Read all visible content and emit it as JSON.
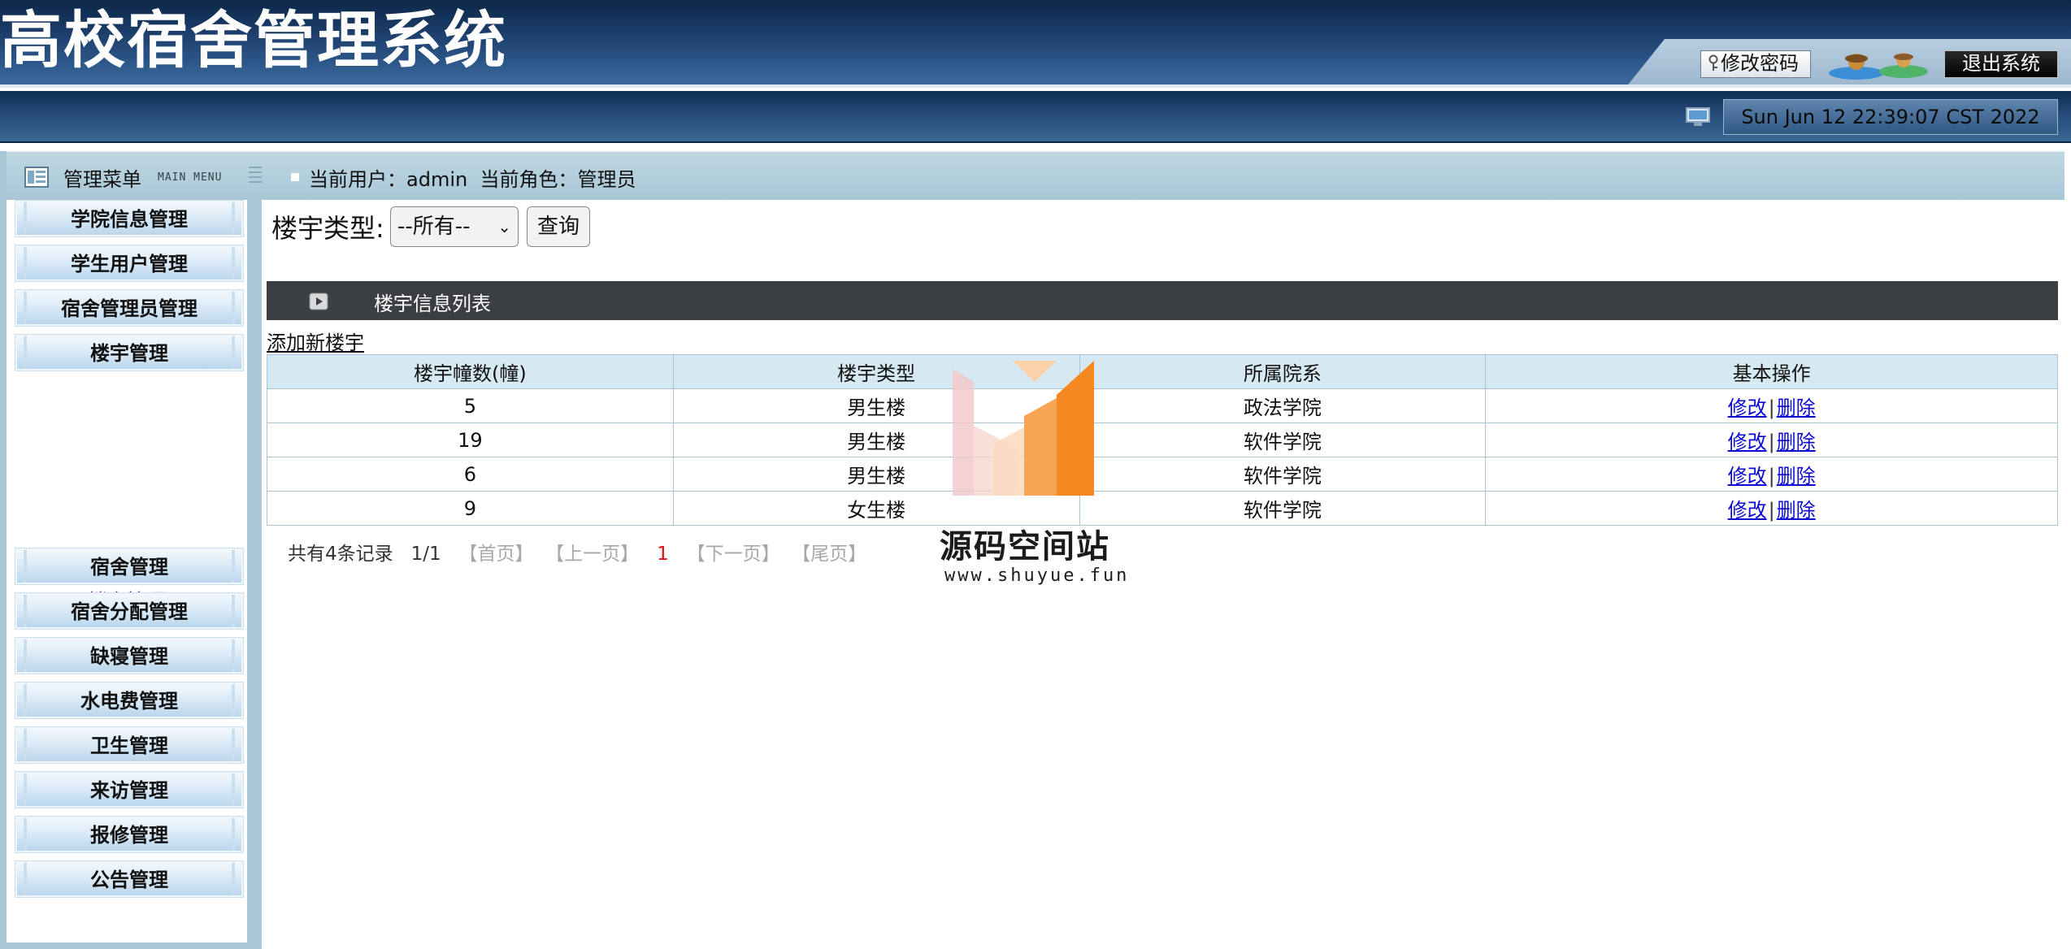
{
  "header": {
    "title": "高校宿舍管理系统",
    "change_password": "修改密码",
    "logout": "退出系统"
  },
  "status": {
    "datetime": "Sun Jun 12 22:39:07 CST 2022"
  },
  "menubar": {
    "title": "管理菜单",
    "title_en": "MAIN MENU",
    "user_info": "当前用户：admin  当前角色：管理员"
  },
  "sidebar": {
    "items": [
      {
        "label": "学院信息管理"
      },
      {
        "label": "学生用户管理"
      },
      {
        "label": "宿舍管理员管理"
      },
      {
        "label": "楼宇管理"
      },
      {
        "label": "宿舍管理"
      },
      {
        "label": "宿舍分配管理"
      },
      {
        "label": "缺寝管理"
      },
      {
        "label": "水电费管理"
      },
      {
        "label": "卫生管理"
      },
      {
        "label": "来访管理"
      },
      {
        "label": "报修管理"
      },
      {
        "label": "公告管理"
      }
    ],
    "submenu": {
      "label": "楼宇管理"
    }
  },
  "filter": {
    "label": "楼宇类型:",
    "selected": "--所有--",
    "query_button": "查询"
  },
  "list": {
    "title": "楼宇信息列表",
    "add_link": "添加新楼宇",
    "columns": [
      "楼宇幢数(幢)",
      "楼宇类型",
      "所属院系",
      "基本操作"
    ],
    "rows": [
      {
        "count": "5",
        "type": "男生楼",
        "dept": "政法学院"
      },
      {
        "count": "19",
        "type": "男生楼",
        "dept": "软件学院"
      },
      {
        "count": "6",
        "type": "男生楼",
        "dept": "软件学院"
      },
      {
        "count": "9",
        "type": "女生楼",
        "dept": "软件学院"
      }
    ],
    "ops": {
      "edit": "修改",
      "sep": "|",
      "delete": "删除"
    }
  },
  "pager": {
    "total": "共有4条记录",
    "page_info": "1/1",
    "first": "【首页】",
    "prev": "【上一页】",
    "current": "1",
    "next": "【下一页】",
    "last": "【尾页】"
  },
  "watermark": {
    "name": "源码空间站",
    "url": "www.shuyue.fun"
  },
  "colors": {
    "header_dark": "#0c2748",
    "menubar": "#a9c7d6",
    "table_header": "#d6e8f1",
    "list_header": "#3b3f44",
    "link": "#0a0ad4",
    "pager_current": "#e01010",
    "submenu_link": "#6b1e8a"
  },
  "icons": [
    "key-icon",
    "users-icon",
    "monitor-icon",
    "menu-icon",
    "grip-icon",
    "play-icon",
    "chevron-down-icon"
  ]
}
